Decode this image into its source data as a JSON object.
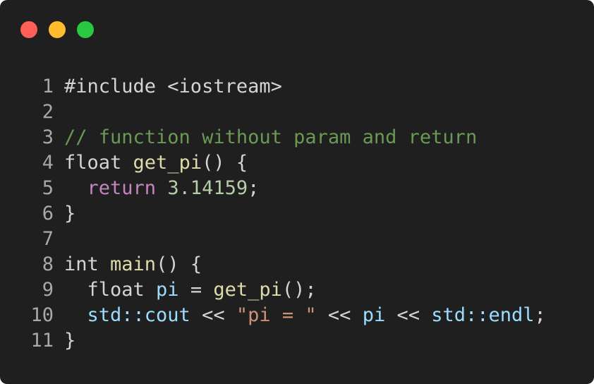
{
  "window": {
    "controls": [
      {
        "name": "close",
        "color": "#ff5f57"
      },
      {
        "name": "minimize",
        "color": "#febc2e"
      },
      {
        "name": "zoom",
        "color": "#28c840"
      }
    ]
  },
  "colors": {
    "plain": "#d4d4d4",
    "comment": "#6a9955",
    "keyword": "#c586c0",
    "function": "#dcdcaa",
    "number": "#b5cea8",
    "variable": "#9cdcfe",
    "string": "#ce9178",
    "line_number": "#a8a8a8"
  },
  "code": {
    "lines": [
      {
        "number": "1",
        "tokens": [
          {
            "text": "#include <iostream>",
            "type": "plain"
          }
        ]
      },
      {
        "number": "2",
        "tokens": []
      },
      {
        "number": "3",
        "tokens": [
          {
            "text": "// function without param and return",
            "type": "comment"
          }
        ]
      },
      {
        "number": "4",
        "tokens": [
          {
            "text": "float ",
            "type": "plain"
          },
          {
            "text": "get_pi",
            "type": "function"
          },
          {
            "text": "() {",
            "type": "plain"
          }
        ]
      },
      {
        "number": "5",
        "tokens": [
          {
            "text": "  ",
            "type": "plain"
          },
          {
            "text": "return",
            "type": "keyword"
          },
          {
            "text": " ",
            "type": "plain"
          },
          {
            "text": "3.14159",
            "type": "number"
          },
          {
            "text": ";",
            "type": "plain"
          }
        ]
      },
      {
        "number": "6",
        "tokens": [
          {
            "text": "}",
            "type": "plain"
          }
        ]
      },
      {
        "number": "7",
        "tokens": []
      },
      {
        "number": "8",
        "tokens": [
          {
            "text": "int ",
            "type": "plain"
          },
          {
            "text": "main",
            "type": "function"
          },
          {
            "text": "() {",
            "type": "plain"
          }
        ]
      },
      {
        "number": "9",
        "tokens": [
          {
            "text": "  float ",
            "type": "plain"
          },
          {
            "text": "pi",
            "type": "variable"
          },
          {
            "text": " = ",
            "type": "plain"
          },
          {
            "text": "get_pi",
            "type": "function"
          },
          {
            "text": "();",
            "type": "plain"
          }
        ]
      },
      {
        "number": "10",
        "tokens": [
          {
            "text": "  ",
            "type": "plain"
          },
          {
            "text": "std::cout",
            "type": "variable"
          },
          {
            "text": " << ",
            "type": "plain"
          },
          {
            "text": "\"pi = \"",
            "type": "string"
          },
          {
            "text": " << ",
            "type": "plain"
          },
          {
            "text": "pi",
            "type": "variable"
          },
          {
            "text": " << ",
            "type": "plain"
          },
          {
            "text": "std::endl",
            "type": "variable"
          },
          {
            "text": ";",
            "type": "plain"
          }
        ]
      },
      {
        "number": "11",
        "tokens": [
          {
            "text": "}",
            "type": "plain"
          }
        ]
      }
    ]
  }
}
